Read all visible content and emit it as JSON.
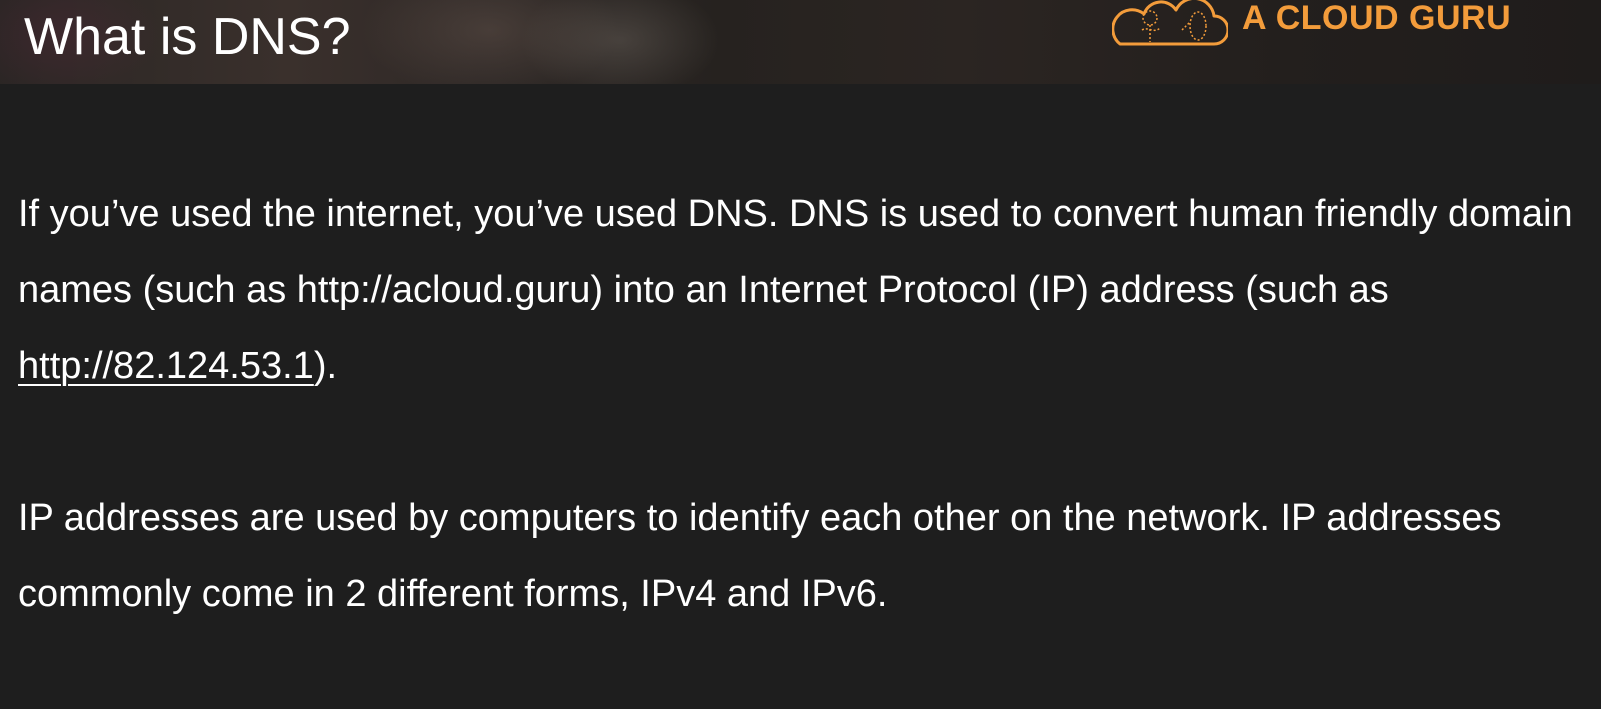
{
  "slide": {
    "title": "What is DNS?",
    "brand": {
      "name": "A CLOUD GURU",
      "logo_icon": "cloud-logo-icon",
      "color": "#f39c3b"
    },
    "paragraph1": {
      "before_link": "If you’ve used the internet, you’ve used DNS. DNS is used to convert human friendly domain names (such as http://acloud.guru) into an Internet Protocol (IP) address (such as ",
      "link_text": "http://82.124.53.1",
      "after_link": ")."
    },
    "paragraph2": "IP addresses are used by computers to identify each other on the network. IP addresses commonly come in 2 different forms, IPv4 and IPv6."
  }
}
